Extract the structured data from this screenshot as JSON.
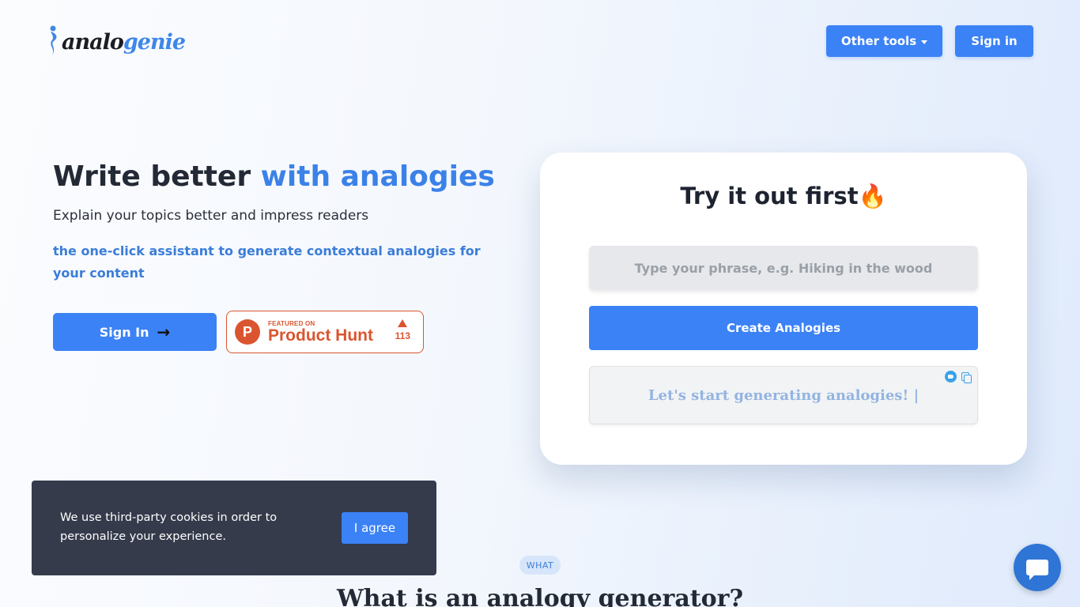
{
  "header": {
    "logo": {
      "part1": "analo",
      "part2": "genie"
    },
    "nav": {
      "other_tools_label": "Other tools",
      "sign_in_label": "Sign in"
    }
  },
  "hero": {
    "title_part1": "Write better ",
    "title_part2": "with analogies",
    "subtitle": "Explain your topics better and impress readers",
    "tagline": "the one-click assistant to generate contextual analogies for your content",
    "sign_in_label": "Sign In",
    "product_hunt": {
      "featured": "FEATURED ON",
      "name": "Product Hunt",
      "logo_letter": "P",
      "votes": "113"
    }
  },
  "card": {
    "title": "Try it out first🔥",
    "input_placeholder": "Type your phrase, e.g. Hiking in the wood",
    "input_value": "",
    "create_label": "Create Analogies",
    "output_text": "Let's start generating analogies! |"
  },
  "section": {
    "badge": "WHAT",
    "title": "What is an analogy generator?"
  },
  "cookie": {
    "text": "We use third-party cookies in order to personalize your experience.",
    "agree_label": "I agree"
  },
  "colors": {
    "accent": "#3b82f6",
    "product_hunt": "#da552f",
    "cookie_bg": "#353b4b"
  },
  "icons": [
    "genie-logo-icon",
    "caret-down-icon",
    "arrow-right-icon",
    "twitter-icon",
    "copy-icon",
    "chat-icon"
  ]
}
